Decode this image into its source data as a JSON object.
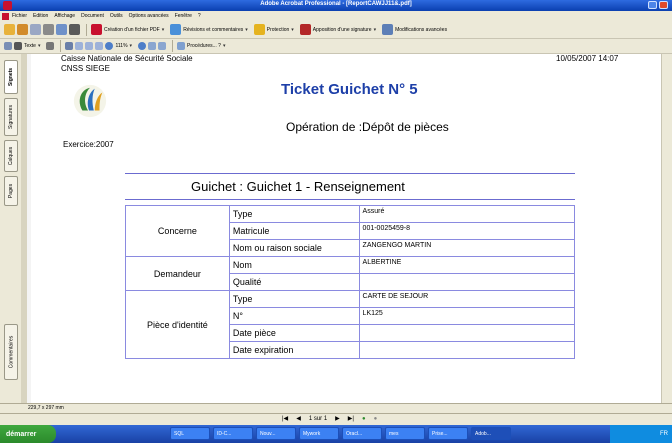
{
  "window": {
    "title": "Adobe Acrobat Professional - [ReportCAWJJ11&.pdf]"
  },
  "menu": [
    "Fichier",
    "Edition",
    "Affichage",
    "Document",
    "Outils",
    "Options avancées",
    "Fenêtre",
    "?"
  ],
  "toolbar1": {
    "create_pdf": "Création d'un fichier PDF",
    "reviews": "Révisions et commentaires",
    "protection": "Protection",
    "signature": "Apposition d'une signature",
    "advanced": "Modifications avancées"
  },
  "toolbar2": {
    "text_tool": "Texte",
    "zoom": "111%",
    "procedures": "Procédures... ?"
  },
  "nav_tabs": [
    "Signets",
    "Signatures",
    "Calques",
    "Pages",
    "Commentaires"
  ],
  "document": {
    "org_name": "Caisse Nationale de Sécurité Sociale",
    "org_site": "CNSS SIEGE",
    "datetime": "10/05/2007 14:07",
    "exercice": "Exercice:2007",
    "ticket_title": "Ticket Guichet N° 5",
    "operation": "Opération de :Dépôt de pièces",
    "guichet": "Guichet : Guichet 1 - Renseignement",
    "rows": [
      {
        "group": "Concerne",
        "label": "Type",
        "value": "Assuré"
      },
      {
        "label": "Matricule",
        "value": "001-0025459-8"
      },
      {
        "label": "Nom ou raison sociale",
        "value": "ZANGENGO MARTIN"
      },
      {
        "group": "Demandeur",
        "label": "Nom",
        "value": "ALBERTINE"
      },
      {
        "label": "Qualité",
        "value": ""
      },
      {
        "group": "Pièce d'identité",
        "label": "Type",
        "value": "CARTE DE SEJOUR"
      },
      {
        "label": "N°",
        "value": "LK125"
      },
      {
        "label": "Date pièce",
        "value": ""
      },
      {
        "label": "Date expiration",
        "value": ""
      }
    ]
  },
  "status": {
    "page_size": "229,7 x 297 mm",
    "page_indicator": "1 sur 1"
  },
  "taskbar": {
    "start": "démarrer",
    "tasks": [
      "SQL",
      "ID-C...",
      "Nouv...",
      "Mywork",
      "Oracl...",
      "mes",
      "Prise...",
      "Adob..."
    ],
    "tray": "FR"
  }
}
